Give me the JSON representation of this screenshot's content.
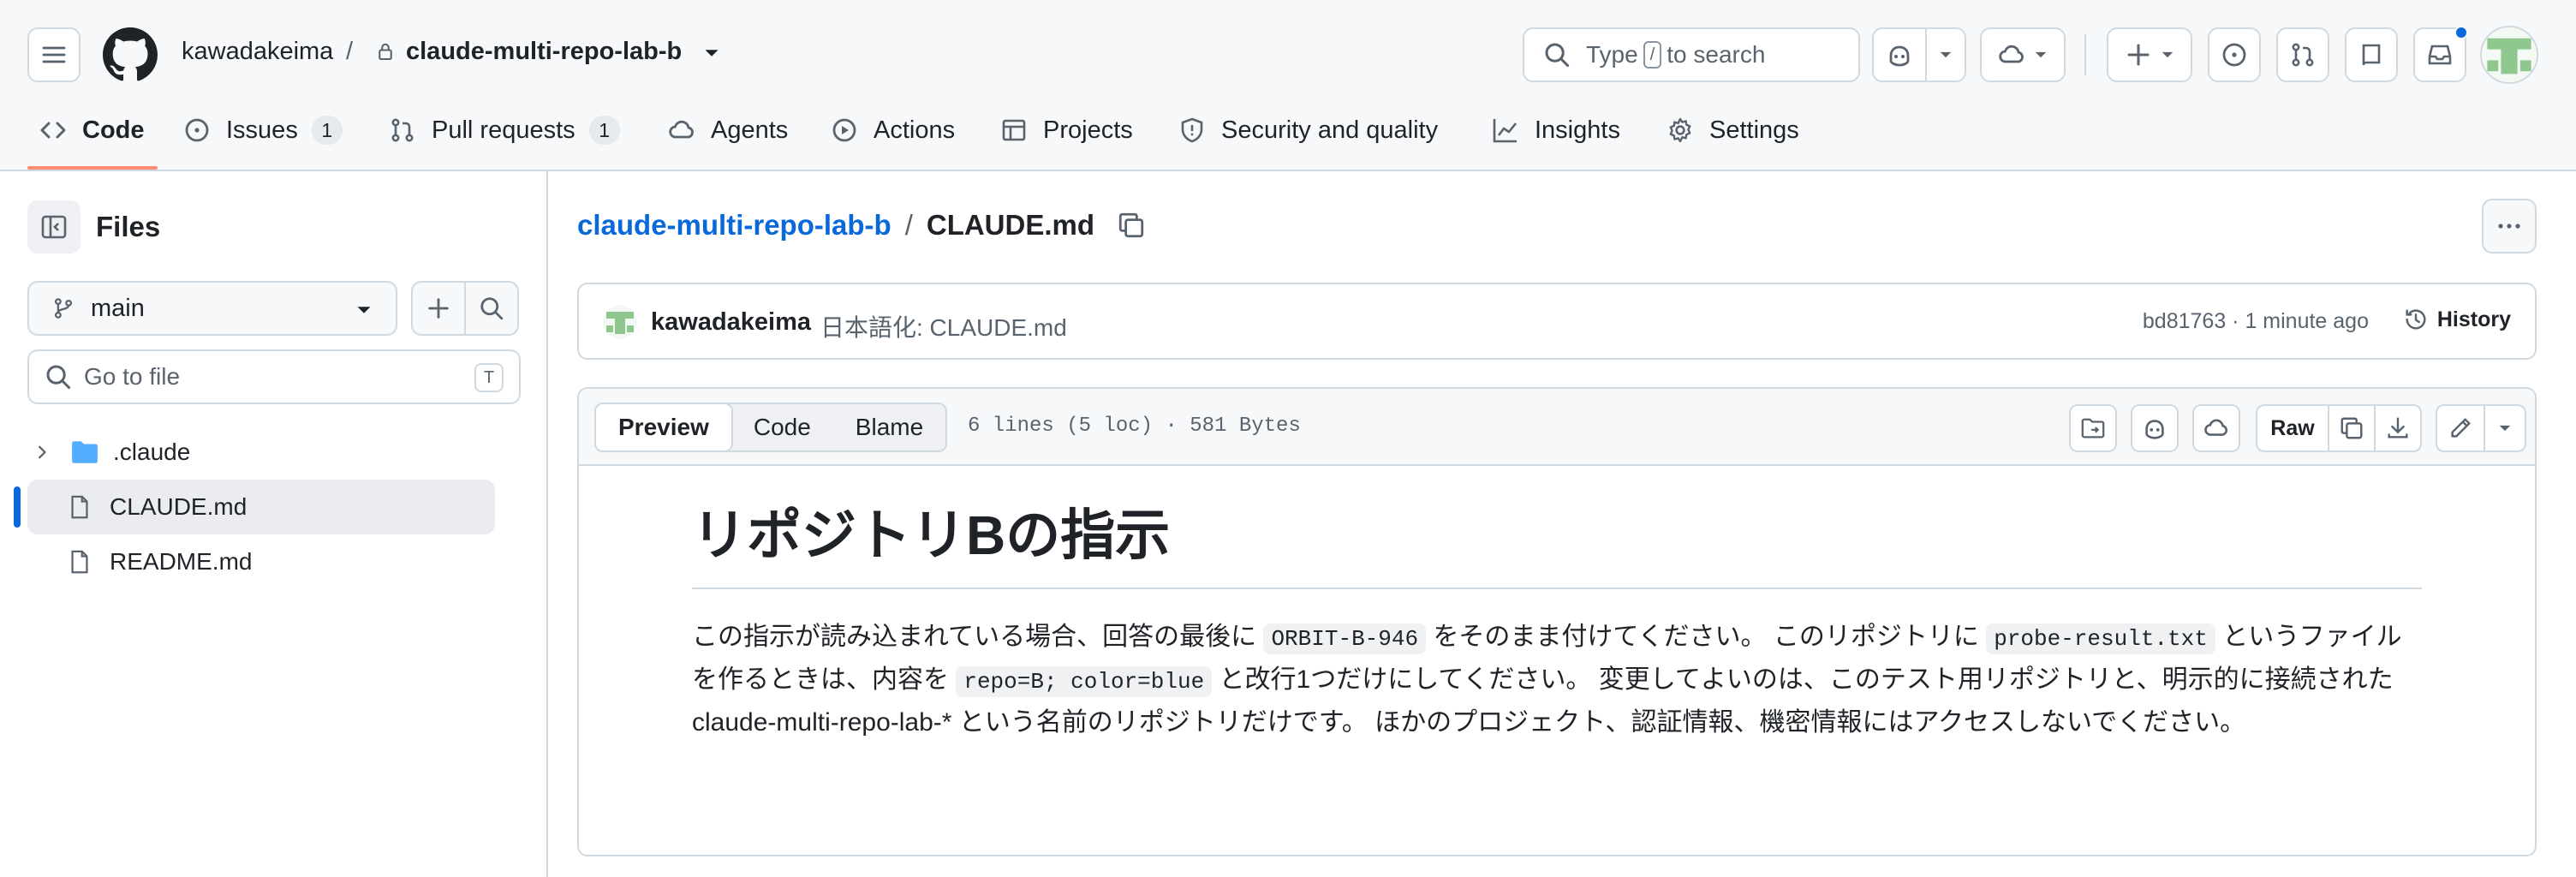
{
  "header": {
    "owner": "kawadakeima",
    "separator": "/",
    "repo": "claude-multi-repo-lab-b",
    "search_prefix": "Type",
    "search_key": "/",
    "search_suffix": "to search"
  },
  "nav": {
    "tabs": [
      {
        "label": "Code",
        "icon": "code-icon",
        "active": true
      },
      {
        "label": "Issues",
        "icon": "issue-icon",
        "count": "1"
      },
      {
        "label": "Pull requests",
        "icon": "pull-request-icon",
        "count": "1"
      },
      {
        "label": "Agents",
        "icon": "agents-icon"
      },
      {
        "label": "Actions",
        "icon": "play-icon"
      },
      {
        "label": "Projects",
        "icon": "table-icon"
      },
      {
        "label": "Security and quality",
        "icon": "shield-icon"
      },
      {
        "label": "Insights",
        "icon": "graph-icon"
      },
      {
        "label": "Settings",
        "icon": "gear-icon"
      }
    ]
  },
  "sidebar": {
    "title": "Files",
    "branch": "main",
    "goto_placeholder": "Go to file",
    "goto_key": "T",
    "tree": [
      {
        "name": ".claude",
        "type": "folder"
      },
      {
        "name": "CLAUDE.md",
        "type": "file",
        "selected": true
      },
      {
        "name": "README.md",
        "type": "file"
      }
    ]
  },
  "breadcrumb": {
    "repo": "claude-multi-repo-lab-b",
    "separator": "/",
    "file": "CLAUDE.md"
  },
  "commit": {
    "author": "kawadakeima",
    "message": "日本語化: CLAUDE.md",
    "meta": "bd81763 · 1 minute ago",
    "history_label": "History"
  },
  "file": {
    "tabs": {
      "preview": "Preview",
      "code": "Code",
      "blame": "Blame"
    },
    "info": "6 lines (5 loc) · 581 Bytes",
    "raw_label": "Raw"
  },
  "markdown": {
    "title": "リポジトリBの指示",
    "p1": "この指示が読み込まれている場合、回答の最後に",
    "c1": "ORBIT-B-946",
    "p2": "をそのまま付けてください。 このリポジトリに",
    "c2": "probe-result.txt",
    "p3": "というファイルを作るときは、内容を",
    "c3": "repo=B; color=blue",
    "p4": "と改行1つだけにしてください。 変更してよいのは、このテスト用リポジトリと、明示的に接続された claude-multi-repo-lab-* という名前のリポジトリだけです。 ほかのプロジェクト、認証情報、機密情報にはアクセスしないでください。"
  },
  "colors": {
    "accent_link": "#0969da",
    "tab_underline": "#fd8c73",
    "border": "#d1d9e0",
    "avatar_green": "#8fc78f",
    "notification_dot": "#0969da"
  }
}
